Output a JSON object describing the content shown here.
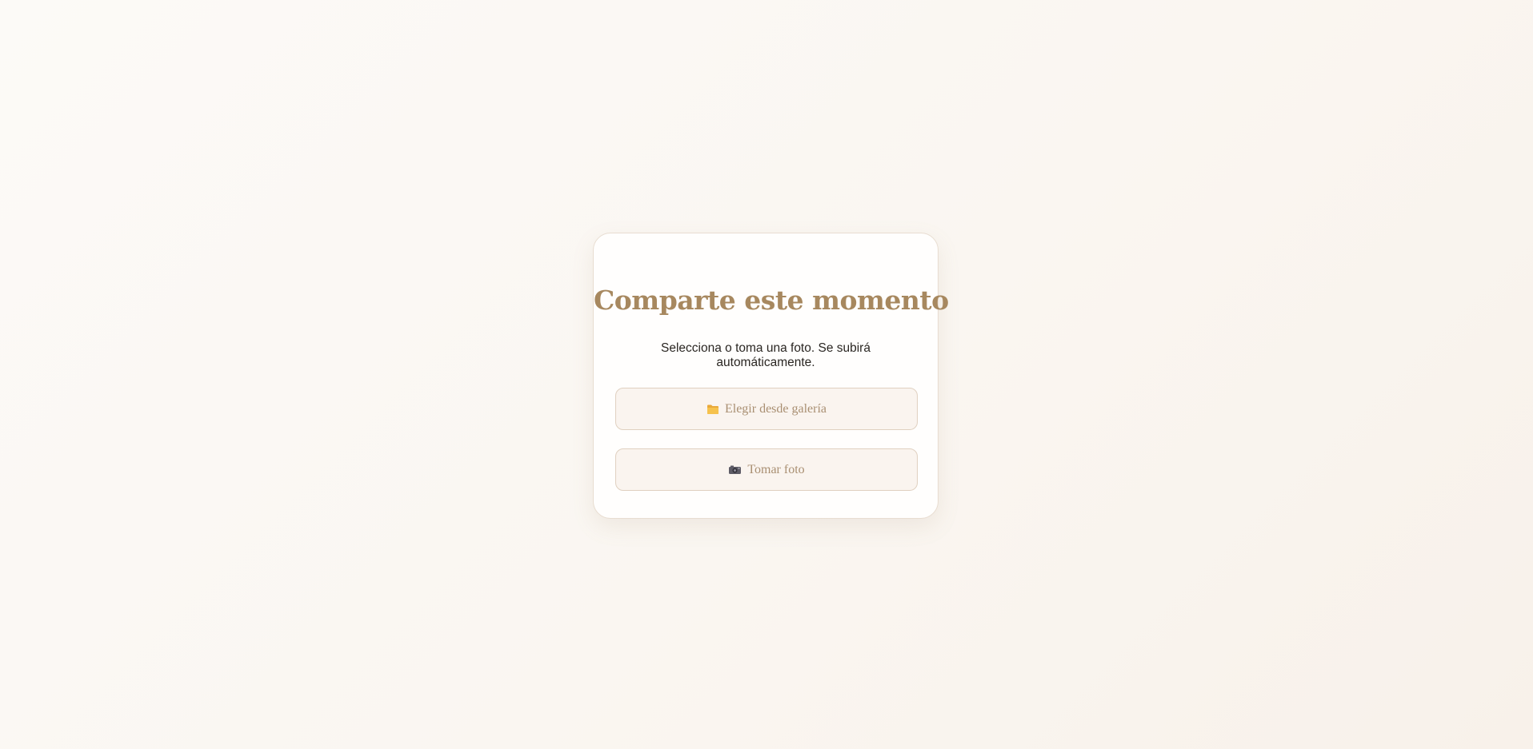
{
  "upload_card": {
    "title": "Comparte este momento",
    "subtitle": "Selecciona o toma una foto. Se subirá automáticamente.",
    "buttons": {
      "gallery": {
        "label": "Elegir desde galería",
        "icon": "folder-icon"
      },
      "camera": {
        "label": "Tomar foto",
        "icon": "camera-icon"
      }
    }
  },
  "colors": {
    "title": "#a7885f",
    "button_text": "#a98f72",
    "button_bg": "#faf4ef",
    "card_bg": "#fffefd"
  }
}
